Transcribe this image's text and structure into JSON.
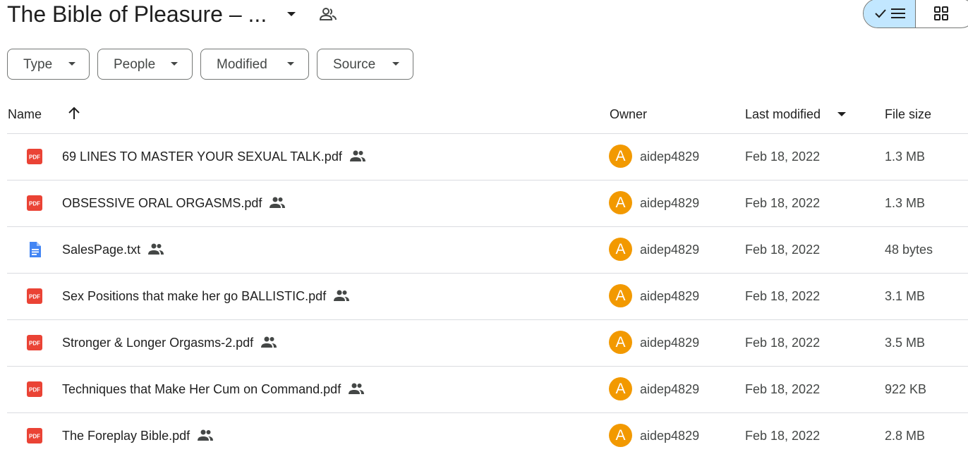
{
  "header": {
    "title": "The Bible of Pleasure – ...",
    "title_menu_icon": "caret-down-icon",
    "shared_icon": "people-outline-icon",
    "view_toggle": {
      "list_selected": true,
      "list_icons": [
        "check-icon",
        "list-icon"
      ],
      "grid_icon": "grid-icon"
    }
  },
  "filters": [
    {
      "label": "Type"
    },
    {
      "label": "People"
    },
    {
      "label": "Modified"
    },
    {
      "label": "Source"
    }
  ],
  "columns": {
    "name": "Name",
    "owner": "Owner",
    "last_modified": "Last modified",
    "file_size": "File size",
    "sort_icon": "arrow-up-icon"
  },
  "files": [
    {
      "name": "69 LINES TO MASTER YOUR  SEXUAL TALK.pdf",
      "type": "pdf",
      "owner_initial": "A",
      "owner": "aidep4829",
      "modified": "Feb 18, 2022",
      "size": "1.3 MB"
    },
    {
      "name": "OBSESSIVE ORAL ORGASMS.pdf",
      "type": "pdf",
      "owner_initial": "A",
      "owner": "aidep4829",
      "modified": "Feb 18, 2022",
      "size": "1.3 MB"
    },
    {
      "name": "SalesPage.txt",
      "type": "txt",
      "owner_initial": "A",
      "owner": "aidep4829",
      "modified": "Feb 18, 2022",
      "size": "48 bytes"
    },
    {
      "name": "Sex Positions that make her go BALLISTIC.pdf",
      "type": "pdf",
      "owner_initial": "A",
      "owner": "aidep4829",
      "modified": "Feb 18, 2022",
      "size": "3.1 MB"
    },
    {
      "name": "Stronger & Longer Orgasms-2.pdf",
      "type": "pdf",
      "owner_initial": "A",
      "owner": "aidep4829",
      "modified": "Feb 18, 2022",
      "size": "3.5 MB"
    },
    {
      "name": "Techniques that Make Her Cum on Command.pdf",
      "type": "pdf",
      "owner_initial": "A",
      "owner": "aidep4829",
      "modified": "Feb 18, 2022",
      "size": "922 KB"
    },
    {
      "name": "The Foreplay Bible.pdf",
      "type": "pdf",
      "owner_initial": "A",
      "owner": "aidep4829",
      "modified": "Feb 18, 2022",
      "size": "2.8 MB"
    }
  ],
  "colors": {
    "pdf_icon": "#ea4335",
    "doc_icon": "#4285f4",
    "avatar": "#f29900",
    "view_selected_bg": "#c2e7ff"
  },
  "pdf_icon_text": "PDF"
}
